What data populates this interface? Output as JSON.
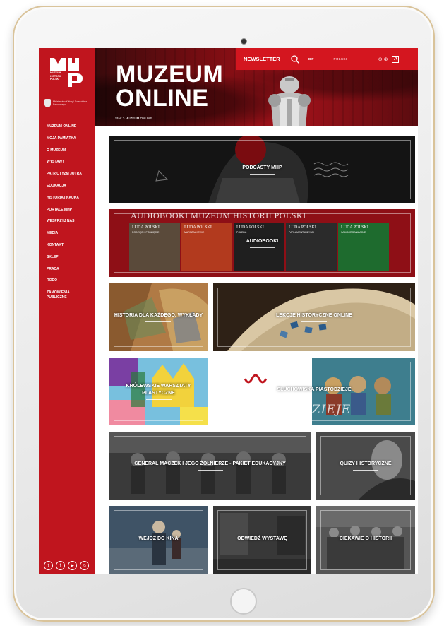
{
  "sidebar": {
    "logo_text": "MUZEUM HISTORII POLSKI",
    "ministry_text": "Ministerstwo Kultury i Dziedzictwa Narodowego",
    "nav": [
      "MUZEUM ONLINE",
      "MOJA PAMIĄTKA",
      "O MUZEUM",
      "WYSTAWY",
      "PATRIOTYZM JUTRA",
      "EDUKACJA",
      "HISTORIA I NAUKA",
      "PORTALE MHP",
      "WESPRZYJ NAS",
      "MEDIA",
      "KONTAKT",
      "SKLEP",
      "PRACA",
      "RODO",
      "ZAMÓWIENIA PUBLICZNE"
    ],
    "socials": [
      "twitter-icon",
      "facebook-icon",
      "youtube-icon",
      "instagram-icon"
    ]
  },
  "header": {
    "title_line1": "MUZEUM",
    "title_line2": "ONLINE",
    "newsletter": "NEWSLETTER",
    "bip": "BIP",
    "language": "POLSKI",
    "zoom": "⊖ ⊕",
    "contrast": "A",
    "breadcrumb": "Start  >  MUZEUM ONLINE"
  },
  "tiles": {
    "podcasty": "PODCASTY MHP",
    "audiobooki": "AUDIOBOOKI",
    "audiobooki_heading": "AUDIOBOOKI MUZEUM HISTORII POLSKI",
    "historia": "HISTORIA DLA KAŻDEGO. WYKŁADY",
    "lekcje": "LEKCJE HISTORYCZNE ONLINE",
    "krolewskie": "KRÓLEWSKIE WARSZTATY PLASTYCZNE",
    "piastodzieje": "SŁUCHOWISKA PIASTODZIEJE",
    "piastodzieje_art": "PIASTODZIEJE",
    "maczek": "GENERAŁ MACZEK I JEGO ŻOŁNIERZE - PAKIET EDUKACYJNY",
    "quizy": "QUIZY HISTORYCZNE",
    "kino": "WEJDŹ DO KINA",
    "wystawe": "ODWIEDŹ WYSTAWĘ",
    "ciekawie": "CIEKAWIE O HISTORII"
  },
  "covers": [
    {
      "title": "LUDA POLSKI",
      "sub": "PODZIĘCI I PODZIĘCIE",
      "color": "#5a4a3a"
    },
    {
      "title": "LUDA POLSKI",
      "sub": "MARSZALKOWIE",
      "color": "#b23a1e"
    },
    {
      "title": "LUDA POLSKI",
      "sub": "POLEDA",
      "color": "#1f1f1f"
    },
    {
      "title": "LUDA POLSKI",
      "sub": "PARLAMENTARZYŚCI",
      "color": "#2b2b2b"
    },
    {
      "title": "LUDA POLSKI",
      "sub": "SAMOORGANIZACJE",
      "color": "#1e6b2e"
    }
  ],
  "colors": {
    "sidebar": "#c0151e",
    "topbar": "#d4161f",
    "accent": "#c0151e"
  }
}
